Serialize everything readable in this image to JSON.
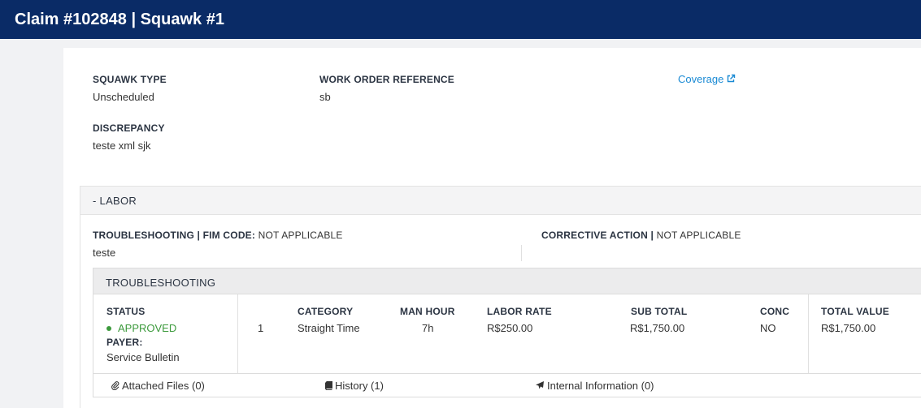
{
  "header": {
    "title": "Claim #102848 | Squawk #1"
  },
  "details": {
    "squawk_type_label": "SQUAWK TYPE",
    "squawk_type_value": "Unscheduled",
    "work_order_label": "WORK ORDER REFERENCE",
    "work_order_value": "sb",
    "discrepancy_label": "DISCREPANCY",
    "discrepancy_value": "teste xml sjk",
    "coverage_link": "Coverage",
    "coverage_icon": "external-link-icon"
  },
  "labor": {
    "toggle_label": "- LABOR",
    "troubleshooting_label": "TROUBLESHOOTING | FIM CODE:",
    "troubleshooting_fim_value": "NOT APPLICABLE",
    "troubleshooting_text": "teste",
    "corrective_action_label": "CORRECTIVE ACTION |",
    "corrective_action_value": "NOT APPLICABLE"
  },
  "troubleshooting_table": {
    "title": "TROUBLESHOOTING",
    "status_label": "STATUS",
    "status_value": "APPROVED",
    "status_color": "#3c9a3c",
    "payer_label": "PAYER:",
    "payer_value": "Service Bulletin",
    "columns": [
      "CATEGORY",
      "MAN HOUR",
      "LABOR RATE",
      "SUB TOTAL",
      "CONC",
      "TOTAL VALUE"
    ],
    "row": {
      "index": "1",
      "category": "Straight Time",
      "man_hour": "7h",
      "labor_rate": "R$250.00",
      "sub_total": "R$1,750.00",
      "conc": "NO",
      "total_value": "R$1,750.00"
    },
    "tabs": [
      {
        "label": "Attached Files (0)",
        "icon": "paperclip-icon"
      },
      {
        "label": "History (1)",
        "icon": "book-icon"
      },
      {
        "label": "Internal Information (0)",
        "icon": "airplane-icon"
      }
    ]
  },
  "colors": {
    "header_bg": "#0a2b66",
    "link": "#1a8ad4",
    "approved": "#3c9a3c"
  }
}
